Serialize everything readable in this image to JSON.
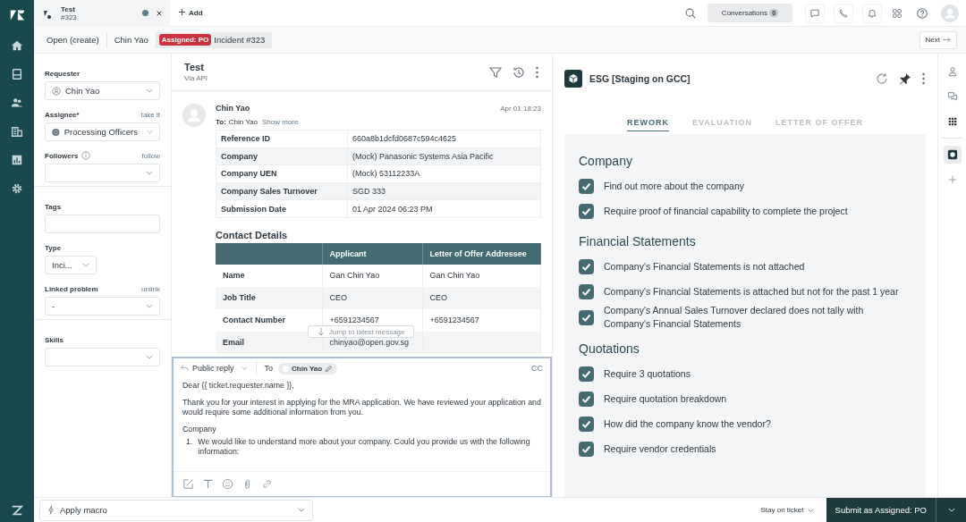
{
  "top_tab": {
    "title": "Test",
    "subtitle": "#323",
    "unread": true
  },
  "add_label": "Add",
  "conversations": {
    "label": "Conversations",
    "count": "0"
  },
  "breadcrumbs": [
    {
      "label": "Open (create)"
    },
    {
      "label": "Chin Yao"
    },
    {
      "badge": "Assigned: PO",
      "label": "Incident #323"
    }
  ],
  "next_label": "Next",
  "sidebar": {
    "groups": [
      {
        "fields": [
          {
            "kind": "select",
            "label": "Requester",
            "value": "Chin Yao"
          },
          {
            "kind": "select",
            "label": "Assignee*",
            "action": "take it",
            "value": "Processing Officers"
          },
          {
            "kind": "select",
            "label": "Followers",
            "info": true,
            "action": "follow"
          }
        ]
      },
      {
        "fields": [
          {
            "kind": "input",
            "label": "Tags"
          },
          {
            "kind": "narrow",
            "label": "Type",
            "value": "Inci..."
          },
          {
            "kind": "select",
            "label": "Linked problem",
            "action": "unlink",
            "value": "-"
          }
        ]
      },
      {
        "fields": [
          {
            "kind": "select",
            "label": "Skills"
          }
        ]
      }
    ]
  },
  "conversation": {
    "title": "Test",
    "channel": "Via API",
    "message": {
      "author": "Chin Yao",
      "time": "Apr 01 18:23",
      "to_label": "To:",
      "to": "Chin Yao",
      "show_more": "Show more",
      "details": [
        {
          "label": "Reference ID",
          "value": "660a8b1dcfd0687c594c4625"
        },
        {
          "label": "Company",
          "value": "(Mock) Panasonic Systems Asia Pacific"
        },
        {
          "label": "Company UEN",
          "value": "(Mock) 53112233A"
        },
        {
          "label": "Company Sales Turnover",
          "value": "SGD 333"
        },
        {
          "label": "Submission Date",
          "value": "01 Apr 2024 06:23 PM"
        }
      ],
      "contact_heading": "Contact Details",
      "contact_columns": [
        "Applicant",
        "Letter of Offer Addressee"
      ],
      "contact_rows": [
        {
          "label": "Name",
          "values": [
            "Gan Chin Yao",
            "Gan Chin Yao"
          ]
        },
        {
          "label": "Job Title",
          "values": [
            "CEO",
            "CEO"
          ]
        },
        {
          "label": "Contact Number",
          "values": [
            "+6591234567",
            "+6591234567"
          ]
        },
        {
          "label": "Email",
          "values": [
            "chinyao@open.gov.sg"
          ]
        }
      ]
    },
    "jump_label": "Jump to latest message"
  },
  "reply": {
    "mode": "Public reply",
    "to_label": "To",
    "recipient": "Chin Yao",
    "cc": "CC",
    "greeting": "Dear {{ ticket.requester.name }},",
    "paragraph": "Thank you for your interest in applying for the MRA application. We have reviewed your application and would require some additional information from you.",
    "heading": "Company",
    "list": [
      {
        "marker": "1.",
        "text": "We would like to understand more about your company. Could you provide us with the following information:"
      }
    ]
  },
  "bottom": {
    "macro": "Apply macro",
    "stay": "Stay on ticket",
    "submit": "Submit as Assigned: PO"
  },
  "app": {
    "title": "ESG [Staging on GCC]",
    "tabs": [
      {
        "label": "REWORK",
        "selected": true
      },
      {
        "label": "EVALUATION",
        "selected": false
      },
      {
        "label": "LETTER OF OFFER",
        "selected": false
      }
    ],
    "sections": [
      {
        "heading": "Company",
        "items": [
          {
            "text": "Find out more about the company",
            "checked": true
          },
          {
            "text": "Require proof of financial capability to complete the project",
            "checked": true
          }
        ]
      },
      {
        "heading": "Financial Statements",
        "items": [
          {
            "text": "Company's Financial Statements is not attached",
            "checked": true
          },
          {
            "text": "Company's Financial Statements is attached but not for the past 1 year",
            "checked": true
          },
          {
            "text": "Company's Annual Sales Turnover declared does not tally with Company's Financial Statements",
            "checked": true
          }
        ]
      },
      {
        "heading": "Quotations",
        "items": [
          {
            "text": "Require 3 quotations",
            "checked": true
          },
          {
            "text": "Require quotation breakdown",
            "checked": true
          },
          {
            "text": "How did the company know the vendor?",
            "checked": true
          },
          {
            "text": "Require vendor credentials",
            "checked": true
          }
        ]
      }
    ]
  },
  "rail": [
    {
      "selected": false
    },
    {
      "selected": false
    },
    {
      "selected": false
    },
    {
      "selected": true
    },
    {
      "selected": false
    }
  ]
}
